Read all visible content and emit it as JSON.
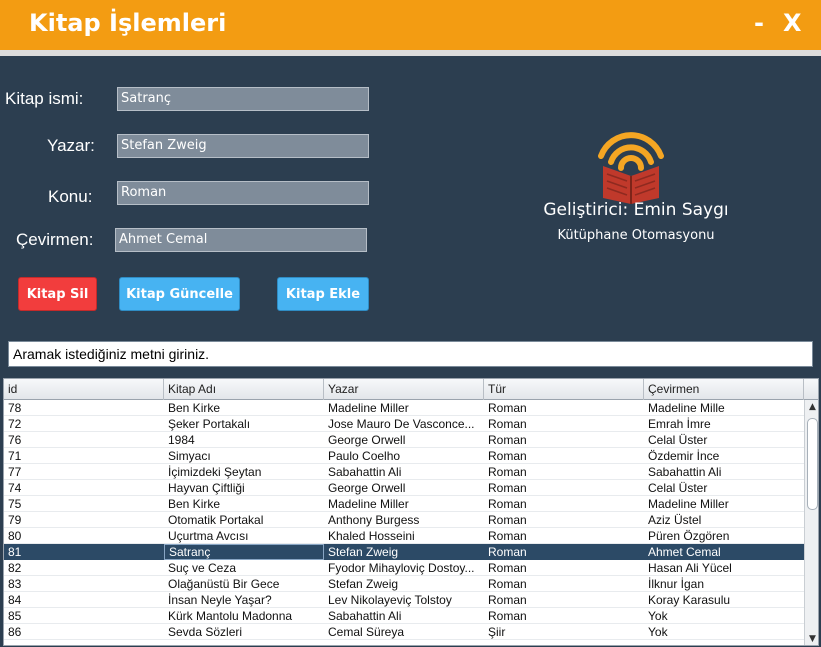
{
  "window": {
    "title": "Kitap İşlemleri",
    "minimize_label": "-",
    "close_label": "X"
  },
  "form": {
    "name_label": "Kitap ismi:",
    "name_value": "Satranç",
    "author_label": "Yazar:",
    "author_value": "Stefan Zweig",
    "subject_label": "Konu:",
    "subject_value": "Roman",
    "translator_label": "Çevirmen:",
    "translator_value": "Ahmet Cemal"
  },
  "buttons": {
    "delete": "Kitap Sil",
    "update": "Kitap Güncelle",
    "add": "Kitap Ekle"
  },
  "branding": {
    "developer": "Geliştirici: Emin Saygı",
    "subtitle": "Kütüphane Otomasyonu",
    "logo_icon": "library-wifi-book-icon",
    "colors": {
      "arc": "#f5a623",
      "book": "#c0392b"
    }
  },
  "search": {
    "value": "Aramak istediğiniz metni giriniz."
  },
  "table": {
    "columns": [
      "id",
      "Kitap Adı",
      "Yazar",
      "Tür",
      "Çevirmen"
    ],
    "selected_row": 9,
    "rows": [
      [
        "78",
        "Ben Kirke",
        "Madeline Miller",
        "Roman",
        "Madeline Mille"
      ],
      [
        "72",
        "Şeker Portakalı",
        "Jose Mauro De Vasconce...",
        "Roman",
        "Emrah İmre"
      ],
      [
        "76",
        "1984",
        "George Orwell",
        "Roman",
        "Celal Üster"
      ],
      [
        "71",
        "Simyacı",
        "Paulo Coelho",
        "Roman",
        "Özdemir İnce"
      ],
      [
        "77",
        "İçimizdeki Şeytan",
        "Sabahattin Ali",
        "Roman",
        "Sabahattin Ali"
      ],
      [
        "74",
        "Hayvan Çiftliği",
        "George Orwell",
        "Roman",
        "Celal Üster"
      ],
      [
        "75",
        "Ben Kirke",
        "Madeline Miller",
        "Roman",
        "Madeline Miller"
      ],
      [
        "79",
        "Otomatik Portakal",
        "Anthony Burgess",
        "Roman",
        "Aziz Üstel"
      ],
      [
        "80",
        "Uçurtma Avcısı",
        " Khaled Hosseini",
        "Roman",
        "Püren Özgören"
      ],
      [
        "81",
        "Satranç",
        "Stefan Zweig",
        "Roman",
        "Ahmet Cemal"
      ],
      [
        "82",
        "Suç ve Ceza",
        "Fyodor Mihayloviç Dostoy...",
        "Roman",
        "Hasan Ali Yücel"
      ],
      [
        "83",
        "Olağanüstü Bir Gece",
        "Stefan Zweig",
        "Roman",
        "İlknur İgan"
      ],
      [
        "84",
        "İnsan Neyle Yaşar?",
        "Lev Nikolayeviç Tolstoy",
        "Roman",
        "Koray Karasulu"
      ],
      [
        "85",
        "Kürk Mantolu Madonna",
        "Sabahattin Ali",
        "Roman",
        "Yok"
      ],
      [
        "86",
        "Sevda Sözleri",
        "Cemal Süreya",
        "Şiir",
        "Yok"
      ]
    ]
  }
}
